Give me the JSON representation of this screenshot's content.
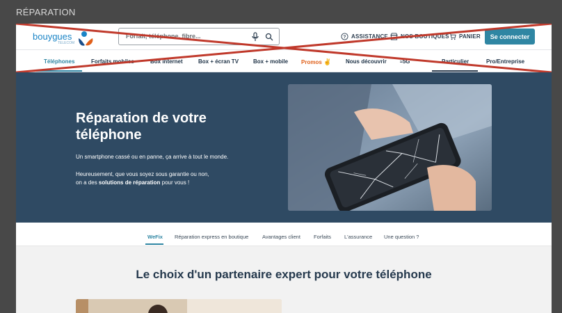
{
  "frame": {
    "label": "RÉPARATION"
  },
  "header": {
    "logo": {
      "text": "bouygues",
      "subtext": "TELECOM"
    },
    "search": {
      "placeholder": "Forfait, téléphone, fibre..."
    },
    "links": {
      "assistance": "ASSISTANCE",
      "boutiques": "NOS BOUTIQUES",
      "panier": "PANIER"
    },
    "connect_button": "Se connecter",
    "icons": [
      "mic-icon",
      "search-icon",
      "help-circle-icon",
      "store-icon",
      "cart-icon"
    ]
  },
  "nav": {
    "items": [
      {
        "label": "Téléphones",
        "active": true
      },
      {
        "label": "Forfaits mobiles"
      },
      {
        "label": "Box internet"
      },
      {
        "label": "Box + écran TV"
      },
      {
        "label": "Box + mobile"
      },
      {
        "label": "Promos"
      },
      {
        "label": "Nous découvrir"
      },
      {
        "label": "5G"
      },
      {
        "label": "Particulier"
      },
      {
        "label": "Pro/Entreprise"
      }
    ]
  },
  "hero": {
    "title": "Réparation de votre téléphone",
    "p1": "Un smartphone cassé ou en panne, ça arrive à tout le monde.",
    "p2_prefix": "Heureusement, que vous soyez sous garantie ou non,",
    "p2_line2_prefix": "on a des ",
    "p2_bold": "solutions de réparation",
    "p2_suffix": " pour vous !"
  },
  "tabs": [
    {
      "label": "WeFix",
      "active": true
    },
    {
      "label": "Réparation express en boutique"
    },
    {
      "label": "Avantages client"
    },
    {
      "label": "Forfaits"
    },
    {
      "label": "L'assurance"
    },
    {
      "label": "Une question ?"
    }
  ],
  "section": {
    "title": "Le choix d'un partenaire expert pour votre téléphone"
  },
  "colors": {
    "hero_bg": "#2f4a63",
    "accent": "#2f86a3",
    "promo": "#e0601a",
    "cross": "#c0392b"
  }
}
